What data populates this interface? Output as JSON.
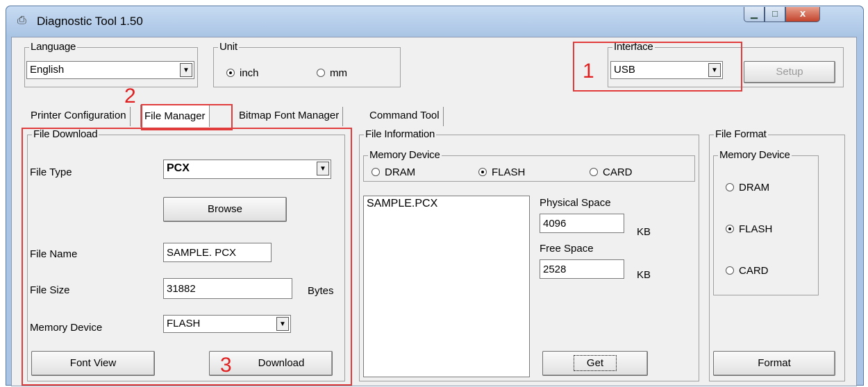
{
  "window": {
    "title": "Diagnostic Tool 1.50"
  },
  "language": {
    "label": "Language",
    "value": "English"
  },
  "unit": {
    "label": "Unit",
    "options": [
      "inch",
      "mm"
    ],
    "selected": "inch"
  },
  "interface": {
    "label": "Interface",
    "value": "USB",
    "setup_label": "Setup"
  },
  "tabs": [
    "Printer Configuration",
    "File Manager",
    "Bitmap Font Manager",
    "Command Tool"
  ],
  "active_tab": "File Manager",
  "file_download": {
    "label": "File Download",
    "file_type_label": "File Type",
    "file_type_value": "PCX",
    "browse_label": "Browse",
    "file_name_label": "File Name",
    "file_name_value": "SAMPLE. PCX",
    "file_size_label": "File Size",
    "file_size_value": "31882",
    "bytes_label": "Bytes",
    "memory_device_label": "Memory Device",
    "memory_device_value": "FLASH",
    "font_view_label": "Font View",
    "download_label": "Download"
  },
  "file_information": {
    "label": "File Information",
    "memory_device_label": "Memory Device",
    "options": [
      "DRAM",
      "FLASH",
      "CARD"
    ],
    "selected": "FLASH",
    "files": [
      "SAMPLE.PCX"
    ],
    "physical_space_label": "Physical Space",
    "physical_space_value": "4096",
    "free_space_label": "Free Space",
    "free_space_value": "2528",
    "kb_label": "KB",
    "get_label": "Get"
  },
  "file_format": {
    "label": "File Format",
    "memory_device_label": "Memory Device",
    "options": [
      "DRAM",
      "FLASH",
      "CARD"
    ],
    "selected": "FLASH",
    "format_label": "Format"
  },
  "annotations": [
    "1",
    "2",
    "3"
  ],
  "colors": {
    "annotation": "#e02020",
    "title_bar": "#a9c4e4",
    "close_button": "#c2422b"
  }
}
